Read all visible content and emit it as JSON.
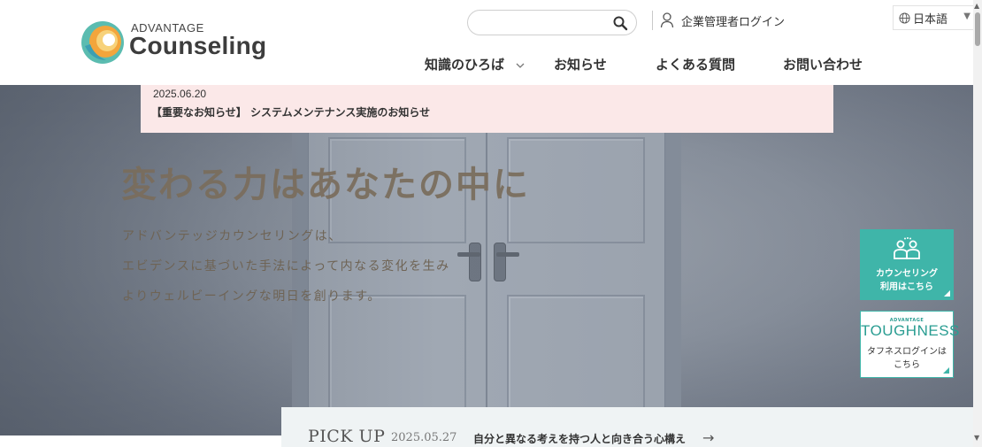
{
  "header": {
    "logo": {
      "small": "ADVANTAGE",
      "big": "Counseling"
    },
    "search": {
      "placeholder": "",
      "value": "",
      "icon": "search-icon"
    },
    "admin_login": {
      "label": "企業管理者ログイン",
      "icon": "user-icon"
    },
    "language": {
      "selected": "日本語",
      "icon": "globe-icon"
    }
  },
  "nav": {
    "items": [
      {
        "label": "知識のひろば",
        "has_dropdown": true
      },
      {
        "label": "お知らせ"
      },
      {
        "label": "よくある質問"
      },
      {
        "label": "お問い合わせ"
      }
    ]
  },
  "notice": {
    "date": "2025.06.20",
    "title": "【重要なお知らせ】 システムメンテナンス実施のお知らせ"
  },
  "hero": {
    "title": "変わる力はあなたの中に",
    "lines": [
      "アドバンテッジカウンセリングは、",
      "エビデンスに基づいた手法によって内なる変化を生み",
      "よりウェルビーイングな明日を創ります。"
    ]
  },
  "widgets": {
    "counseling": {
      "line1": "カウンセリング",
      "line2": "利用はこちら",
      "color": "#3fb5a9"
    },
    "toughness": {
      "small": "ADVANTAGE",
      "brand": "TOUGHNESS",
      "line1": "タフネスログインは",
      "line2": "こちら"
    }
  },
  "pickup": {
    "label": "PICK UP",
    "date": "2025.05.27",
    "title": "自分と異なる考えを持つ人と向き合う心構え",
    "arrow": "→"
  }
}
